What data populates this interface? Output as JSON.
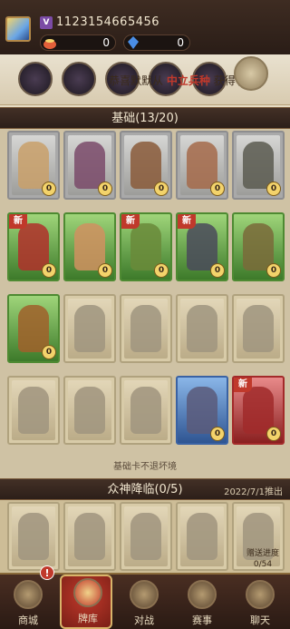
{
  "player": {
    "uid": "1123154665456",
    "uid_icon": "V"
  },
  "resources": [
    {
      "name": "gold-pot-icon",
      "value": "0",
      "color": "#e2603a"
    },
    {
      "name": "crystal-icon",
      "value": "0",
      "color": "#4a8ee6"
    }
  ],
  "banner": {
    "god_icons": [
      "god-icon-1",
      "god-icon-2",
      "god-icon-3",
      "god-icon-4",
      "god-icon-5"
    ],
    "marquee_pre": "恭喜默默从",
    "marquee_hl": "中立兵种",
    "marquee_post": "获得了"
  },
  "section1": {
    "title": "基础(13/20)",
    "note": "基础卡不退坏境"
  },
  "section2": {
    "title": "众神降临(0/5)",
    "side": "2022/7/1推出",
    "progress_label": "赠送进度",
    "progress_value": "0/54"
  },
  "cards_rows": [
    [
      {
        "rarity": "grey",
        "new": false,
        "lv": "0",
        "fig": "#c9a06a"
      },
      {
        "rarity": "grey",
        "new": false,
        "lv": "0",
        "fig": "#7a4a6a"
      },
      {
        "rarity": "grey",
        "new": false,
        "lv": "0",
        "fig": "#8a5a3a"
      },
      {
        "rarity": "grey",
        "new": false,
        "lv": "0",
        "fig": "#a56a4a"
      },
      {
        "rarity": "grey",
        "new": false,
        "lv": "0",
        "fig": "#5a5a50"
      }
    ],
    [
      {
        "rarity": "green",
        "new": true,
        "lv": "0",
        "fig": "#b0302a"
      },
      {
        "rarity": "green",
        "new": false,
        "lv": "0",
        "fig": "#d09060"
      },
      {
        "rarity": "green",
        "new": true,
        "lv": "0",
        "fig": "#6a8a3a"
      },
      {
        "rarity": "green",
        "new": true,
        "lv": "0",
        "fig": "#4a4a5a"
      },
      {
        "rarity": "green",
        "new": false,
        "lv": "0",
        "fig": "#7a6a3a"
      }
    ],
    [
      {
        "rarity": "green",
        "new": false,
        "lv": "0",
        "fig": "#a0602a"
      },
      {
        "rarity": "locked",
        "new": false,
        "lv": "",
        "fig": "#9a8f7a"
      },
      {
        "rarity": "locked",
        "new": false,
        "lv": "",
        "fig": "#9a8f7a"
      },
      {
        "rarity": "locked",
        "new": false,
        "lv": "",
        "fig": "#9a8f7a"
      },
      {
        "rarity": "locked",
        "new": false,
        "lv": "",
        "fig": "#9a8f7a"
      }
    ],
    [
      {
        "rarity": "locked",
        "new": false,
        "lv": "",
        "fig": "#9a8f7a"
      },
      {
        "rarity": "locked",
        "new": false,
        "lv": "",
        "fig": "#9a8f7a"
      },
      {
        "rarity": "locked",
        "new": false,
        "lv": "",
        "fig": "#9a8f7a"
      },
      {
        "rarity": "blue",
        "new": false,
        "lv": "0",
        "fig": "#5a5a7a"
      },
      {
        "rarity": "red",
        "new": true,
        "lv": "0",
        "fig": "#a02a2a"
      }
    ]
  ],
  "god_cards": [
    {
      "rarity": "locked"
    },
    {
      "rarity": "locked"
    },
    {
      "rarity": "locked"
    },
    {
      "rarity": "locked"
    },
    {
      "rarity": "locked"
    }
  ],
  "nav": [
    {
      "label": "商城",
      "icon": "shop-icon",
      "badge": "!"
    },
    {
      "label": "牌库",
      "icon": "card-library-icon",
      "active": true
    },
    {
      "label": "对战",
      "icon": "crossed-swords-icon"
    },
    {
      "label": "赛事",
      "icon": "trophy-icon"
    },
    {
      "label": "聊天",
      "icon": "chat-fist-icon"
    }
  ]
}
